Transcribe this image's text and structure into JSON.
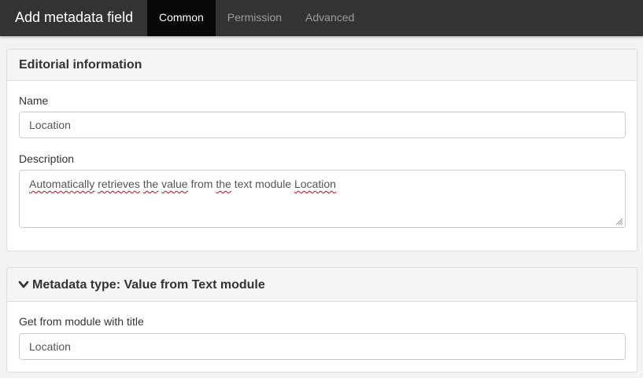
{
  "window": {
    "title": "Add metadata field"
  },
  "tabs": [
    {
      "label": "Common",
      "active": true
    },
    {
      "label": "Permission",
      "active": false
    },
    {
      "label": "Advanced",
      "active": false
    }
  ],
  "editorial": {
    "heading": "Editorial information",
    "name_label": "Name",
    "name_value": "Location",
    "description_label": "Description",
    "description_words": [
      "Automatically",
      "retrieves",
      "the",
      "value",
      "from",
      "the",
      "text",
      "module",
      "Location"
    ]
  },
  "metadata_type": {
    "heading": "Metadata type: Value from Text module",
    "icon": "chevron-down-icon",
    "module_label": "Get from module with title",
    "module_value": "Location"
  },
  "colors": {
    "topbar": "#333333",
    "active_tab": "#080808",
    "spellcheck": "#d0021b"
  }
}
